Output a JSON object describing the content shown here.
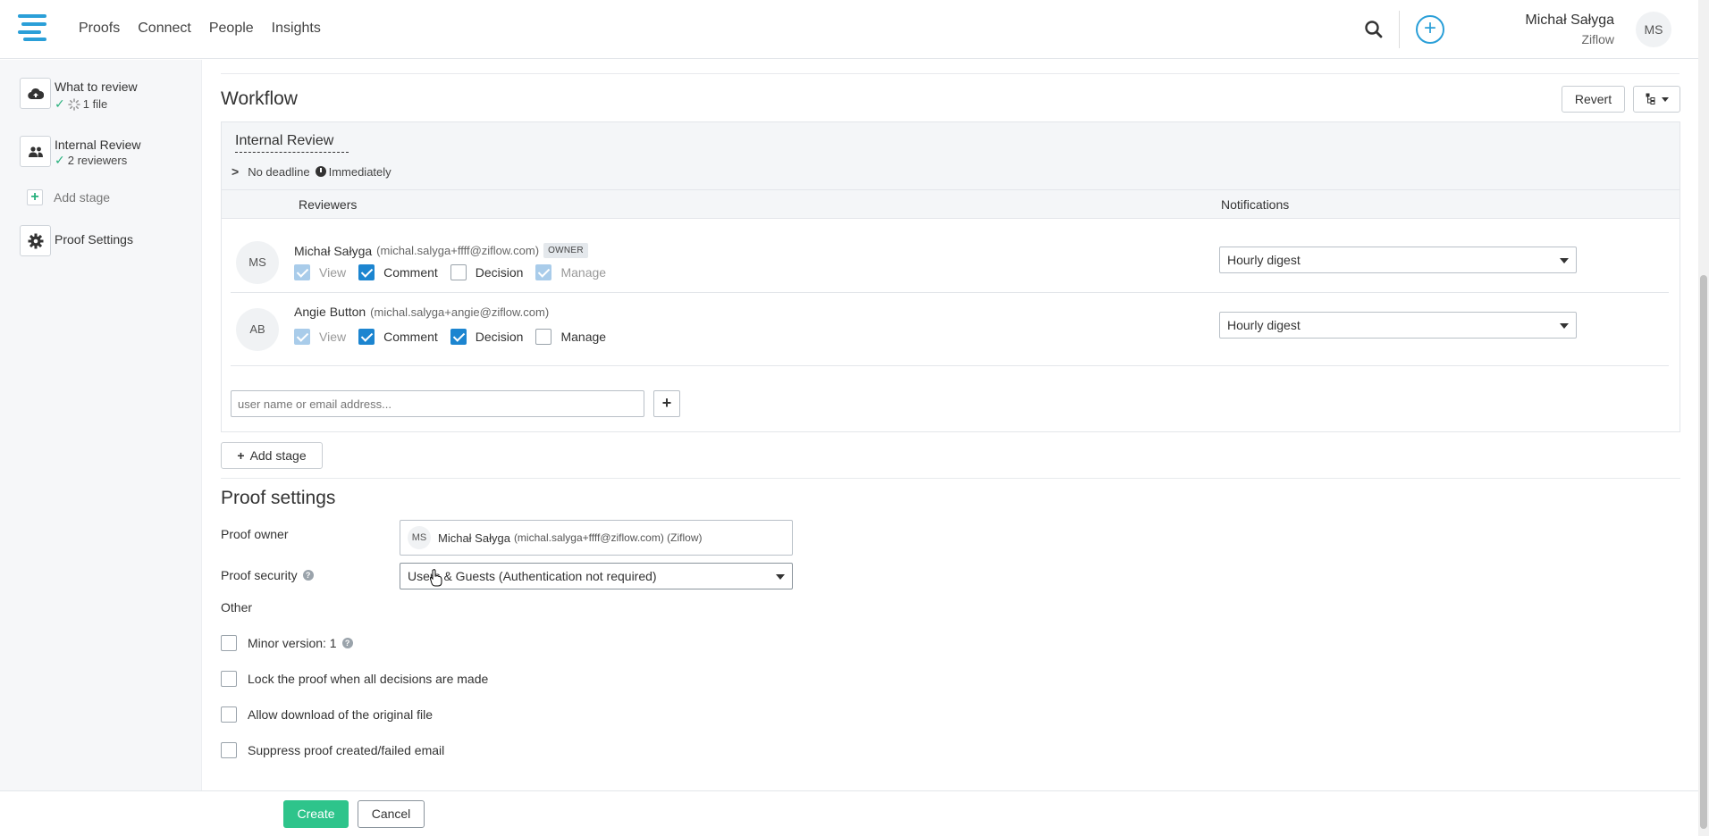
{
  "nav": {
    "items": [
      "Proofs",
      "Connect",
      "People",
      "Insights"
    ]
  },
  "user": {
    "name": "Michał Sałyga",
    "org": "Ziflow",
    "initials": "MS"
  },
  "sidebar": {
    "what_to_review": {
      "title": "What to review",
      "sub": "1 file"
    },
    "internal_review": {
      "title": "Internal Review",
      "sub": "2 reviewers"
    },
    "add_stage": "Add stage",
    "proof_settings": "Proof Settings"
  },
  "workflow": {
    "title": "Workflow",
    "revert_label": "Revert",
    "stage": {
      "name": "Internal Review",
      "deadline": "No deadline",
      "start": "Immediately",
      "col_reviewers": "Reviewers",
      "col_notifications": "Notifications",
      "reviewers": [
        {
          "initials": "MS",
          "name": "Michał Sałyga",
          "email": "(michal.salyga+ffff@ziflow.com)",
          "badge": "OWNER",
          "perm_view": "View",
          "perm_comment": "Comment",
          "perm_decision": "Decision",
          "perm_manage": "Manage",
          "notification": "Hourly digest"
        },
        {
          "initials": "AB",
          "name": "Angie Button",
          "email": "(michal.salyga+angie@ziflow.com)",
          "perm_view": "View",
          "perm_comment": "Comment",
          "perm_decision": "Decision",
          "perm_manage": "Manage",
          "notification": "Hourly digest"
        }
      ],
      "user_input_placeholder": "user name or email address..."
    },
    "add_stage_label": "Add stage"
  },
  "proof_settings": {
    "title": "Proof settings",
    "owner_label": "Proof owner",
    "owner_initials": "MS",
    "owner_name": "Michał Sałyga",
    "owner_email": "(michal.salyga+ffff@ziflow.com) (Ziflow)",
    "security_label": "Proof security",
    "security_value": "Users & Guests (Authentication not required)",
    "other_label": "Other",
    "options": [
      "Minor version: 1",
      "Lock the proof when all decisions are made",
      "Allow download of the original file",
      "Suppress proof created/failed email"
    ]
  },
  "footer": {
    "create_label": "Create",
    "cancel_label": "Cancel"
  },
  "colors": {
    "accent": "#2a9fd8",
    "success": "#2ec48b",
    "checkbox": "#1c85d0"
  }
}
